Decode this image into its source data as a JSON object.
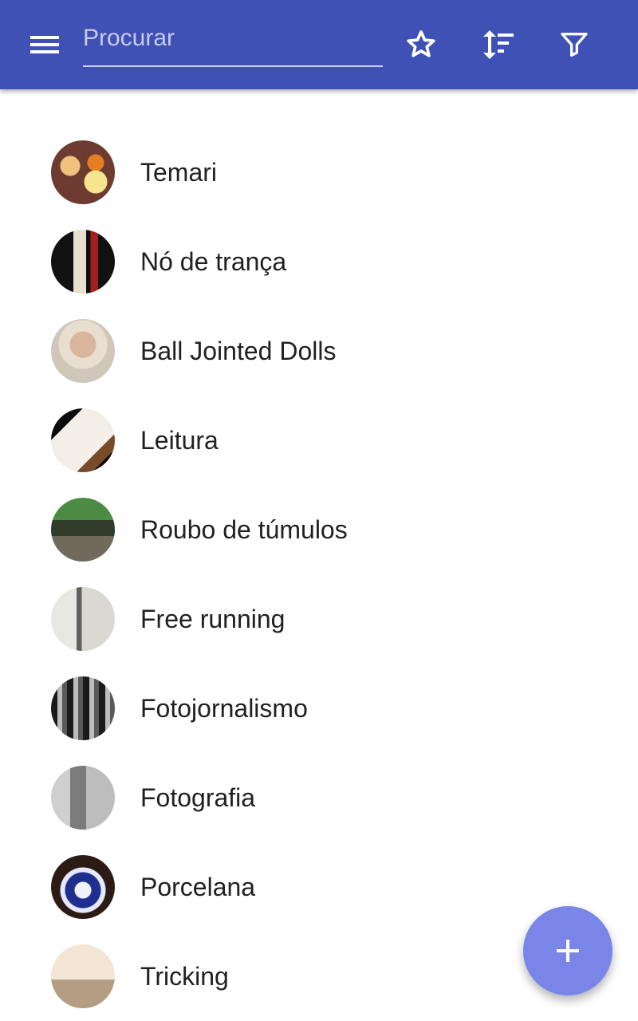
{
  "toolbar": {
    "search_placeholder": "Procurar",
    "search_value": "",
    "icons": [
      "menu-icon",
      "star-icon",
      "sort-icon",
      "filter-icon"
    ],
    "colors": {
      "primary": "#3F51B5",
      "fab": "#7986E8"
    }
  },
  "list": {
    "items": [
      {
        "label": "Temari"
      },
      {
        "label": "Nó de trança"
      },
      {
        "label": "Ball Jointed Dolls"
      },
      {
        "label": "Leitura"
      },
      {
        "label": "Roubo de túmulos"
      },
      {
        "label": "Free running"
      },
      {
        "label": "Fotojornalismo"
      },
      {
        "label": "Fotografia"
      },
      {
        "label": "Porcelana"
      },
      {
        "label": "Tricking"
      }
    ]
  },
  "fab": {
    "icon": "plus-icon"
  }
}
